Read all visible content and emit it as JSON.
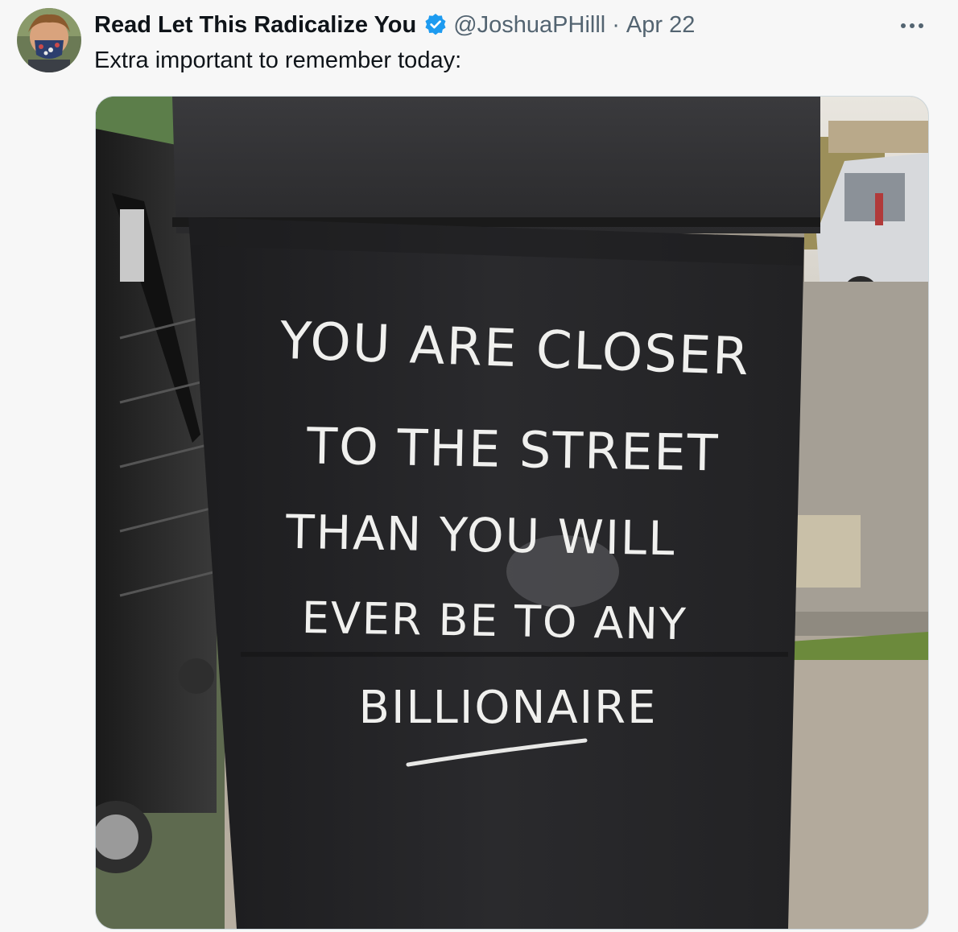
{
  "tweet": {
    "author_name": "Read Let This Radicalize You",
    "handle": "@JoshuaPHilll",
    "separator": "·",
    "date": "Apr 22",
    "text": "Extra important to remember today:",
    "verified": true,
    "more_icon": "more-horizontal-icon",
    "verified_icon": "verified-badge-icon",
    "accent_color": "#1d9bf0",
    "name_color": "#0f1419",
    "meta_color": "#536471"
  },
  "media": {
    "chalk_lines": [
      "YOU ARE CLOSER",
      "TO THE STREET",
      "THAN YOU WILL",
      "EVER BE TO ANY",
      "BILLIONAIRE"
    ]
  }
}
